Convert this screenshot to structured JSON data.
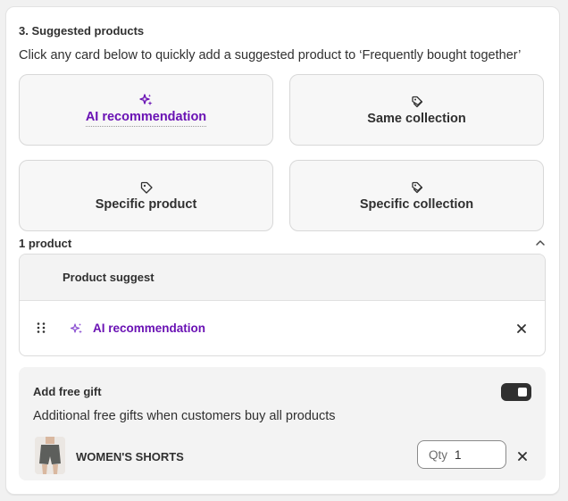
{
  "section": {
    "title": "3. Suggested products",
    "description": "Click any card below to quickly add a suggested product to ‘Frequently bought together’"
  },
  "cards": [
    {
      "label": "AI recommendation",
      "icon": "sparkle-icon"
    },
    {
      "label": "Same collection",
      "icon": "tags-icon"
    },
    {
      "label": "Specific product",
      "icon": "tag-icon"
    },
    {
      "label": "Specific collection",
      "icon": "tags-icon"
    }
  ],
  "products": {
    "count_label": "1 product",
    "header": "Product suggest",
    "rows": [
      {
        "label": "AI recommendation",
        "icon": "sparkle-icon"
      }
    ]
  },
  "gift": {
    "title": "Add free gift",
    "enabled": true,
    "description": "Additional free gifts when customers buy all products",
    "item_name": "WOMEN'S SHORTS",
    "qty_label": "Qty",
    "qty_value": "1"
  },
  "colors": {
    "accent": "#6a12b4",
    "text": "#303030",
    "toggle_on": "#303030",
    "card_bg": "#f7f7f7"
  }
}
